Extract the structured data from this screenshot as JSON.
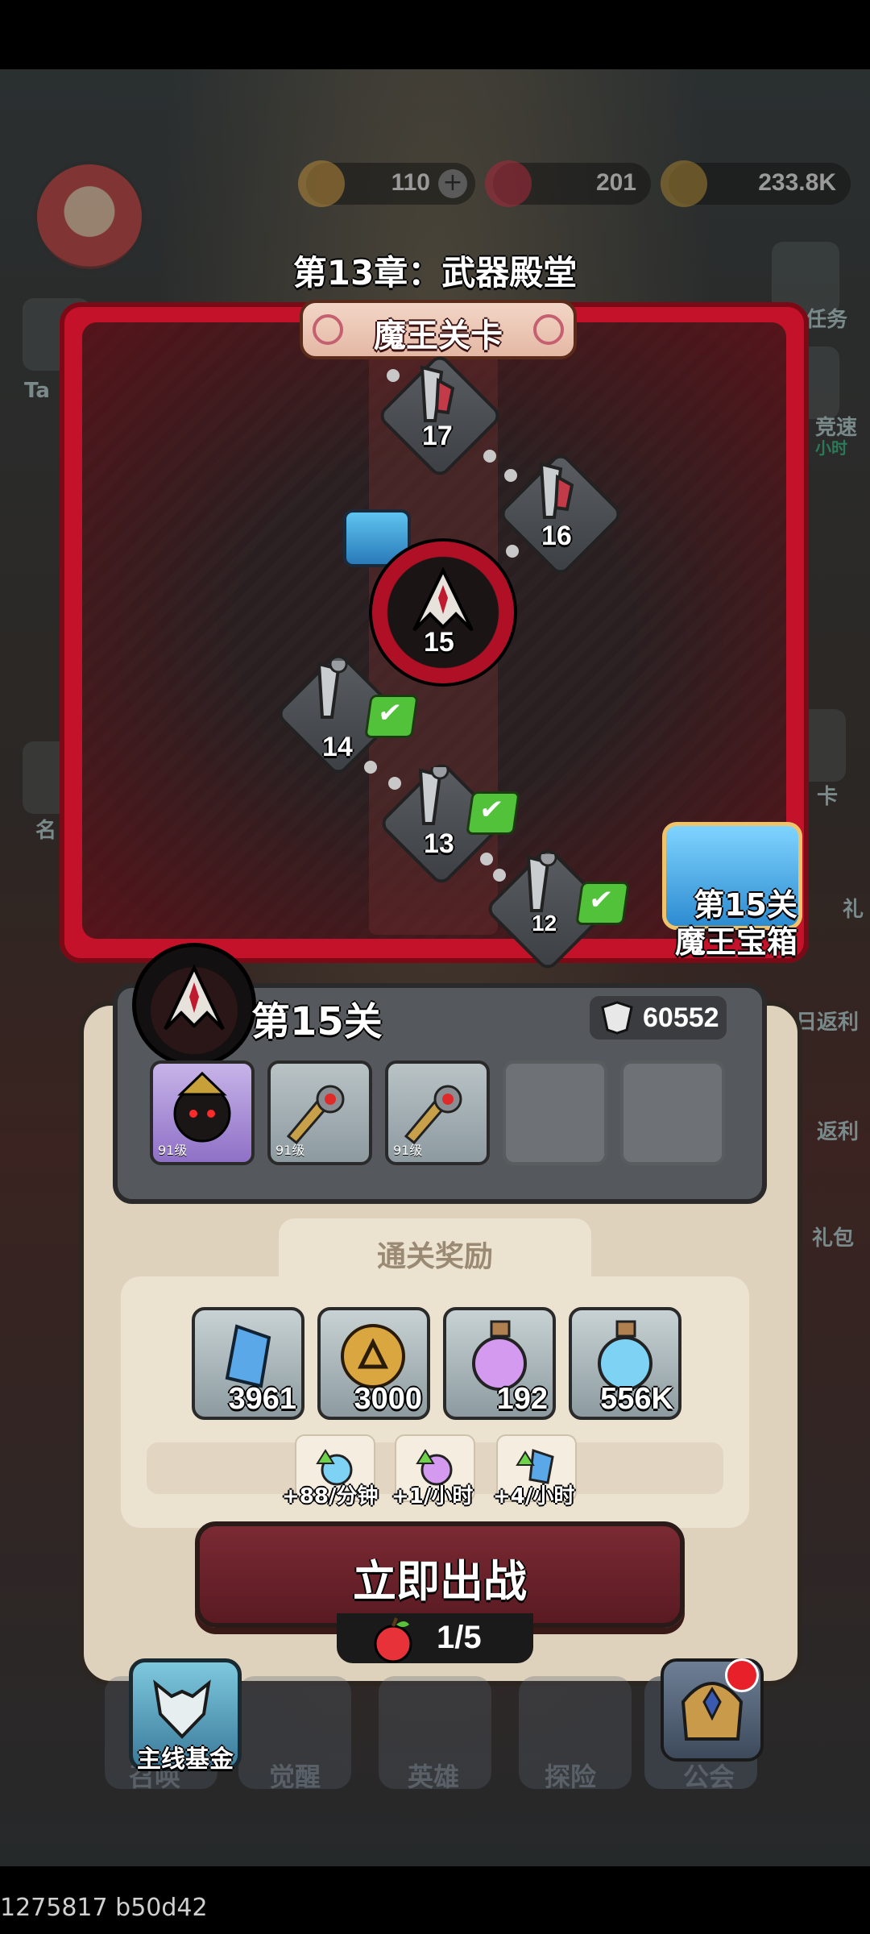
{
  "resources": [
    {
      "icon": "gold-gem-icon",
      "value": "110"
    },
    {
      "icon": "red-gem-icon",
      "value": "201"
    },
    {
      "icon": "coin-icon",
      "value": "233.8K"
    }
  ],
  "side_left": [
    "Ta",
    "名"
  ],
  "side_right": [
    "任务",
    "竞速",
    "小时",
    "卡",
    "礼",
    "日返利",
    "返利",
    "礼包"
  ],
  "chapter": {
    "title": "第13章：武器殿堂",
    "banner": "魔王关卡"
  },
  "stages": [
    {
      "num": "17",
      "cleared": false
    },
    {
      "num": "16",
      "cleared": false
    },
    {
      "num": "15",
      "cleared": false,
      "current": true
    },
    {
      "num": "14",
      "cleared": true
    },
    {
      "num": "13",
      "cleared": true
    },
    {
      "num": "12",
      "cleared": true
    }
  ],
  "boss_chest": {
    "line1": "第15关",
    "line2": "魔王宝箱"
  },
  "level_panel": {
    "title": "第15关",
    "power": "60552",
    "enemies": [
      {
        "level": "91级",
        "icon": "dark-lord-icon"
      },
      {
        "level": "91级",
        "icon": "sword-icon"
      },
      {
        "level": "91级",
        "icon": "sword-icon"
      }
    ],
    "rewards_title": "通关奖励",
    "rewards": [
      {
        "icon": "blue-crystal-icon",
        "value": "3961"
      },
      {
        "icon": "gold-coin-icon",
        "value": "3000"
      },
      {
        "icon": "purple-potion-icon",
        "value": "192"
      },
      {
        "icon": "blue-potion-icon",
        "value": "556K"
      }
    ],
    "rates": [
      {
        "icon": "blue-potion-up-icon",
        "value": "+88/分钟"
      },
      {
        "icon": "purple-potion-up-icon",
        "value": "+1/小时"
      },
      {
        "icon": "crystal-up-icon",
        "value": "+4/小时"
      }
    ],
    "fight_label": "立即出战",
    "stamina": "1/5"
  },
  "bottom_nav": [
    {
      "label": "召唤"
    },
    {
      "label": "觉醒"
    },
    {
      "label": "英雄"
    },
    {
      "label": "探险"
    },
    {
      "label": "公会"
    }
  ],
  "fund_button": "主线基金",
  "build_id": "1275817 b50d42",
  "colors": {
    "frame_red": "#c4122a",
    "check_green": "#52c23a",
    "panel_bg": "#dfd2bd",
    "fight_btn": "#6a2229"
  }
}
